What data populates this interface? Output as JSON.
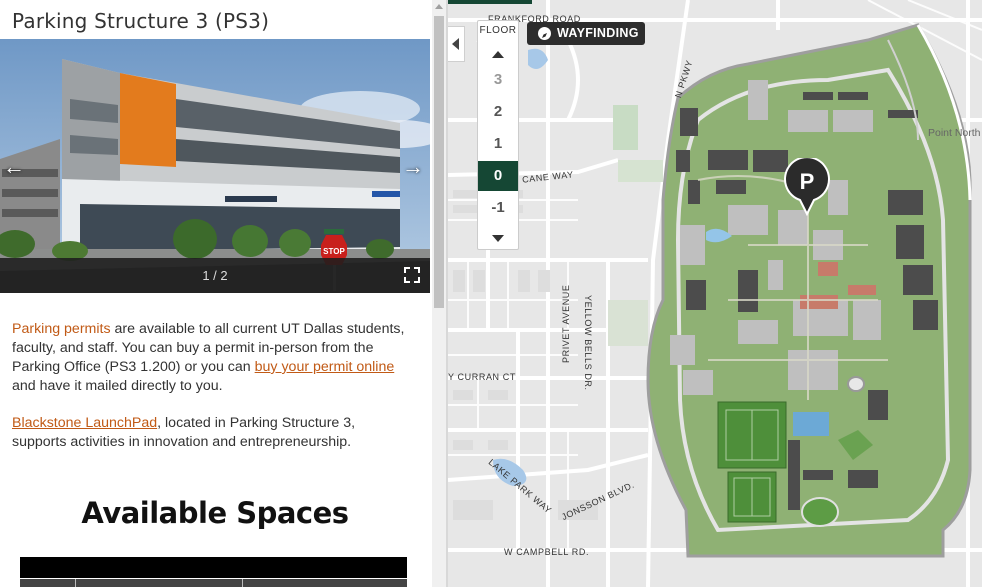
{
  "panel": {
    "title": "Parking Structure 3 (PS3)",
    "gallery": {
      "counter": "1 / 2",
      "prev_icon": "arrow-left-icon",
      "next_icon": "arrow-right-icon",
      "fullscreen_icon": "fullscreen-icon",
      "sign_stop": "STOP"
    },
    "body": {
      "para1_link1": "Parking permits",
      "para1_text1": " are available to all current UT Dallas students, faculty, and staff. You can buy a permit in-person from the Parking Office (PS3 1.200) or you can ",
      "para1_link2": "buy your permit online",
      "para1_text2": " and have it mailed directly to you.",
      "para2_link": "Blackstone LaunchPad",
      "para2_text": ", located in Parking Structure 3, supports activities in innovation and entrepreneurship."
    },
    "available_title": "Available Spaces"
  },
  "map": {
    "floor_selector": {
      "title": "FLOOR",
      "floors": [
        "3",
        "2",
        "1",
        "0",
        "-1"
      ],
      "active": "0"
    },
    "wayfinding_label": "WAYFINDING",
    "streets": {
      "frankford": "FRANKFORD ROAD",
      "pkwy": "N PKWY",
      "cane": "CANE WAY",
      "privet": "PRIVET AVENUE",
      "yellowbells": "YELLOW BELLS DR.",
      "curran": "Y CURRAN CT",
      "lakepark": "LAKE PARK WAY",
      "jonsson": "JONSSON BLVD.",
      "campbell": "W CAMPBELL RD."
    },
    "poi_label": "Point North",
    "marker_letter": "P",
    "colors": {
      "brand_green": "#154734",
      "map_bg": "#e6e6e6",
      "campus_green": "#8fb174",
      "link_orange": "#c15a16"
    }
  }
}
